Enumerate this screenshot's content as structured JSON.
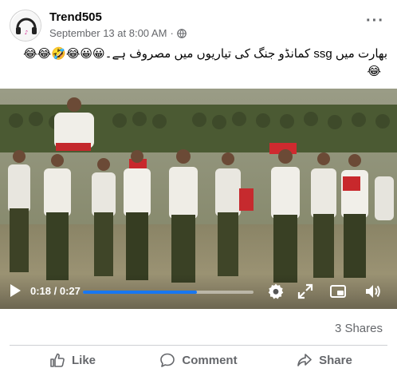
{
  "post": {
    "author": "Trend505",
    "timestamp": "September 13 at 8:00 AM",
    "separator": "·",
    "privacy_icon": "globe-icon",
    "more_label": "···",
    "caption": "بھارت میں ssg کمانڈو جنگ کی تیاریوں میں مصروف ہے۔😀😀😂🤣😂😂",
    "caption_trailing_emoji": "😂"
  },
  "video": {
    "current_time": "0:18",
    "duration": "0:27",
    "time_label": "0:18 / 0:27",
    "progress_fraction": 0.67,
    "accent_color": "#1877f2",
    "controls": [
      "play-icon",
      "settings-icon",
      "fullscreen-icon",
      "picture-in-picture-icon",
      "volume-icon"
    ]
  },
  "stats": {
    "shares": "3 Shares"
  },
  "actions": {
    "like": "Like",
    "comment": "Comment",
    "share": "Share"
  },
  "colors": {
    "secondary_text": "#65676b",
    "divider": "#ced0d4"
  }
}
